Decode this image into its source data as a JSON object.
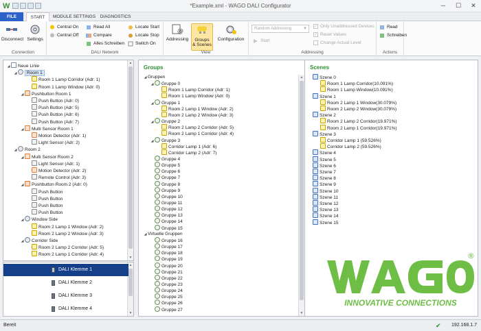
{
  "window": {
    "title": "*Example.xml - WAGO DALI Configurator",
    "controls": [
      "minimize-icon",
      "maximize-icon",
      "close-icon"
    ]
  },
  "tabs": [
    "FILE",
    "START",
    "MODULE SETTINGS",
    "DIAGNOSTICS"
  ],
  "ribbon": {
    "connection": {
      "label": "Connection",
      "disconnect": "Disconnect",
      "settings": "Settings"
    },
    "dali_network": {
      "label": "DALI Network",
      "central_on": "Central On",
      "central_off": "Central Off",
      "read_all": "Read All",
      "compare": "Compare",
      "alles_schreiben": "Alles Schreiben",
      "locate_start": "Locate Start",
      "locate_stop": "Locate Stop",
      "switch_on": "Switch On"
    },
    "view": {
      "label": "View",
      "addressing": "Addressing",
      "groups_scenes_1": "Groups",
      "groups_scenes_2": "& Scenes",
      "configuration": "Configuration"
    },
    "addressing": {
      "label": "Addressing",
      "mode": "Random Addressing",
      "start": "Start",
      "only_unaddressed": "Only Unaddressed Devices",
      "reset_values": "Reset Values",
      "change_actual_level": "Change Actual Level"
    },
    "actions": {
      "label": "Actions",
      "read": "Read",
      "schreiben": "Schreiben"
    }
  },
  "left_tree": [
    {
      "label": "Neue Linie",
      "indent": 0,
      "icon": "root",
      "expand": "▲"
    },
    {
      "label": "Room 1",
      "indent": 1,
      "icon": "room",
      "expand": "▲",
      "selected": true
    },
    {
      "label": "Room 1 Lamp  Corridor (Adr: 1)",
      "indent": 3,
      "icon": "lamp"
    },
    {
      "label": "Room 1 Lamp Window (Adr: 0)",
      "indent": 3,
      "icon": "lamp"
    },
    {
      "label": "Pushbutton Room 1",
      "indent": 2,
      "icon": "push",
      "expand": "▲"
    },
    {
      "label": "Push Button (Adr: 0)",
      "indent": 3,
      "icon": "btn"
    },
    {
      "label": "Push Button (Adr: 5)",
      "indent": 3,
      "icon": "btn"
    },
    {
      "label": "Push Button (Adr: 6)",
      "indent": 3,
      "icon": "btn"
    },
    {
      "label": "Push Button (Adr: 7)",
      "indent": 3,
      "icon": "btn"
    },
    {
      "label": "Multi Sensor Room 1",
      "indent": 2,
      "icon": "sens",
      "expand": "▲"
    },
    {
      "label": "Motion Detector (Adr: 1)",
      "indent": 3,
      "icon": "sens"
    },
    {
      "label": "Light Sensor (Adr: 2)",
      "indent": 3,
      "icon": "btn"
    },
    {
      "label": "Room 2",
      "indent": 1,
      "icon": "room",
      "expand": "▲"
    },
    {
      "label": "Multi Sensor Room 2",
      "indent": 2,
      "icon": "sens",
      "expand": "▲"
    },
    {
      "label": "Light Sensor (Adr: 1)",
      "indent": 3,
      "icon": "btn"
    },
    {
      "label": "Motion Detector (Adr: 2)",
      "indent": 3,
      "icon": "sens"
    },
    {
      "label": "Remote Control (Adr: 3)",
      "indent": 3,
      "icon": "btn"
    },
    {
      "label": "Pushbutton Room 2 (Adr: 0)",
      "indent": 2,
      "icon": "push",
      "expand": "▲"
    },
    {
      "label": "Push Button",
      "indent": 3,
      "icon": "btn"
    },
    {
      "label": "Push Button",
      "indent": 3,
      "icon": "btn"
    },
    {
      "label": "Push Button",
      "indent": 3,
      "icon": "btn"
    },
    {
      "label": "Push Button",
      "indent": 3,
      "icon": "btn"
    },
    {
      "label": "Window Side",
      "indent": 2,
      "icon": "blind",
      "expand": "▲"
    },
    {
      "label": "Room 2 Lamp 1 Window (Adr: 2)",
      "indent": 3,
      "icon": "lamp"
    },
    {
      "label": "Room 2 Lamp 2 Window (Adr: 3)",
      "indent": 3,
      "icon": "lamp"
    },
    {
      "label": "Corridor Side",
      "indent": 2,
      "icon": "blind",
      "expand": "▲"
    },
    {
      "label": "Room 2 Lamp 2 Corridor (Adr: 5)",
      "indent": 3,
      "icon": "lamp"
    },
    {
      "label": "Room 2 Lamp 1 Corridor (Adr: 4)",
      "indent": 3,
      "icon": "lamp"
    }
  ],
  "dali_modules": [
    {
      "label": "DALI Klemme 1",
      "active": true
    },
    {
      "label": "DALI Klemme 2",
      "active": false
    },
    {
      "label": "DALI Klemme 3",
      "active": false
    },
    {
      "label": "DALI Klemme 4",
      "active": false
    }
  ],
  "groups": {
    "title": "Groups",
    "items": [
      {
        "label": "Gruppen",
        "indent": 0,
        "expand": "▲"
      },
      {
        "label": "Gruppe 0",
        "indent": 1,
        "icon": "grp",
        "expand": "▲"
      },
      {
        "label": "Room 1 Lamp  Corridor (Adr: 1)",
        "indent": 2,
        "icon": "lamp"
      },
      {
        "label": "Room 1 Lamp Window (Adr: 0)",
        "indent": 2,
        "icon": "lamp"
      },
      {
        "label": "Gruppe 1",
        "indent": 1,
        "icon": "grp",
        "expand": "▲"
      },
      {
        "label": "Room 2 Lamp 1 Window (Adr: 2)",
        "indent": 2,
        "icon": "lamp"
      },
      {
        "label": "Room 2 Lamp 2 Window (Adr: 3)",
        "indent": 2,
        "icon": "lamp"
      },
      {
        "label": "Gruppe 2",
        "indent": 1,
        "icon": "grp",
        "expand": "▲"
      },
      {
        "label": "Room 2 Lamp 2 Corridor (Adr: 5)",
        "indent": 2,
        "icon": "lamp"
      },
      {
        "label": "Room 2 Lamp 1 Corridor (Adr: 4)",
        "indent": 2,
        "icon": "lamp"
      },
      {
        "label": "Gruppe 3",
        "indent": 1,
        "icon": "grp",
        "expand": "▲"
      },
      {
        "label": "Corridor Lamp 1 (Adr: 6)",
        "indent": 2,
        "icon": "lamp"
      },
      {
        "label": "Corridor Lamp 2 (Adr: 7)",
        "indent": 2,
        "icon": "lamp"
      },
      {
        "label": "Gruppe 4",
        "indent": 1,
        "icon": "grp"
      },
      {
        "label": "Gruppe 5",
        "indent": 1,
        "icon": "grp"
      },
      {
        "label": "Gruppe 6",
        "indent": 1,
        "icon": "grp"
      },
      {
        "label": "Gruppe 7",
        "indent": 1,
        "icon": "grp"
      },
      {
        "label": "Gruppe 8",
        "indent": 1,
        "icon": "grp"
      },
      {
        "label": "Gruppe 9",
        "indent": 1,
        "icon": "grp"
      },
      {
        "label": "Gruppe 10",
        "indent": 1,
        "icon": "grp"
      },
      {
        "label": "Gruppe 11",
        "indent": 1,
        "icon": "grp"
      },
      {
        "label": "Gruppe 12",
        "indent": 1,
        "icon": "grp"
      },
      {
        "label": "Gruppe 13",
        "indent": 1,
        "icon": "grp"
      },
      {
        "label": "Gruppe 14",
        "indent": 1,
        "icon": "grp"
      },
      {
        "label": "Gruppe 15",
        "indent": 1,
        "icon": "grp"
      },
      {
        "label": "Virtuelle Gruppen",
        "indent": 0,
        "expand": "▲"
      },
      {
        "label": "Gruppe 16",
        "indent": 1,
        "icon": "grp"
      },
      {
        "label": "Gruppe 17",
        "indent": 1,
        "icon": "grp"
      },
      {
        "label": "Gruppe 18",
        "indent": 1,
        "icon": "grp"
      },
      {
        "label": "Gruppe 19",
        "indent": 1,
        "icon": "grp"
      },
      {
        "label": "Gruppe 20",
        "indent": 1,
        "icon": "grp"
      },
      {
        "label": "Gruppe 21",
        "indent": 1,
        "icon": "grp"
      },
      {
        "label": "Gruppe 22",
        "indent": 1,
        "icon": "grp"
      },
      {
        "label": "Gruppe 23",
        "indent": 1,
        "icon": "grp"
      },
      {
        "label": "Gruppe 24",
        "indent": 1,
        "icon": "grp"
      },
      {
        "label": "Gruppe 25",
        "indent": 1,
        "icon": "grp"
      },
      {
        "label": "Gruppe 26",
        "indent": 1,
        "icon": "grp"
      },
      {
        "label": "Gruppe 27",
        "indent": 1,
        "icon": "grp"
      }
    ]
  },
  "scenes": {
    "title": "Scenes",
    "items": [
      {
        "label": "Szene 0",
        "indent": 0,
        "icon": "scene"
      },
      {
        "label": "Room 1 Lamp  Corridor(10.091%)",
        "indent": 1,
        "icon": "lamp"
      },
      {
        "label": "Room 1 Lamp Window(10.091%)",
        "indent": 1,
        "icon": "lamp"
      },
      {
        "label": "Szene 1",
        "indent": 0,
        "icon": "scene"
      },
      {
        "label": "Room 2 Lamp 1 Window(30.079%)",
        "indent": 1,
        "icon": "lamp"
      },
      {
        "label": "Room 2 Lamp 2 Window(30.079%)",
        "indent": 1,
        "icon": "lamp"
      },
      {
        "label": "Szene 2",
        "indent": 0,
        "icon": "scene"
      },
      {
        "label": "Room 2 Lamp 2 Corridor(19.971%)",
        "indent": 1,
        "icon": "lamp"
      },
      {
        "label": "Room 2 Lamp 1 Corridor(19.971%)",
        "indent": 1,
        "icon": "lamp"
      },
      {
        "label": "Szene 3",
        "indent": 0,
        "icon": "scene"
      },
      {
        "label": "Corridor Lamp 1 (59.526%)",
        "indent": 1,
        "icon": "lamp"
      },
      {
        "label": "Corridor Lamp 2 (59.526%)",
        "indent": 1,
        "icon": "lamp"
      },
      {
        "label": "Szene 4",
        "indent": 0,
        "icon": "scene"
      },
      {
        "label": "Szene 5",
        "indent": 0,
        "icon": "scene"
      },
      {
        "label": "Szene 6",
        "indent": 0,
        "icon": "scene"
      },
      {
        "label": "Szene 7",
        "indent": 0,
        "icon": "scene"
      },
      {
        "label": "Szene 8",
        "indent": 0,
        "icon": "scene"
      },
      {
        "label": "Szene 9",
        "indent": 0,
        "icon": "scene"
      },
      {
        "label": "Szene 10",
        "indent": 0,
        "icon": "scene"
      },
      {
        "label": "Szene 11",
        "indent": 0,
        "icon": "scene"
      },
      {
        "label": "Szene 12",
        "indent": 0,
        "icon": "scene"
      },
      {
        "label": "Szene 13",
        "indent": 0,
        "icon": "scene"
      },
      {
        "label": "Szene 14",
        "indent": 0,
        "icon": "scene"
      },
      {
        "label": "Szene 15",
        "indent": 0,
        "icon": "scene"
      }
    ]
  },
  "logo": {
    "brand": "WAGO",
    "tagline": "INNOVATIVE CONNECTIONS",
    "registered": "®",
    "color": "#6ebe45"
  },
  "status": {
    "left": "Bereit",
    "ip": "192.168.1.7"
  }
}
